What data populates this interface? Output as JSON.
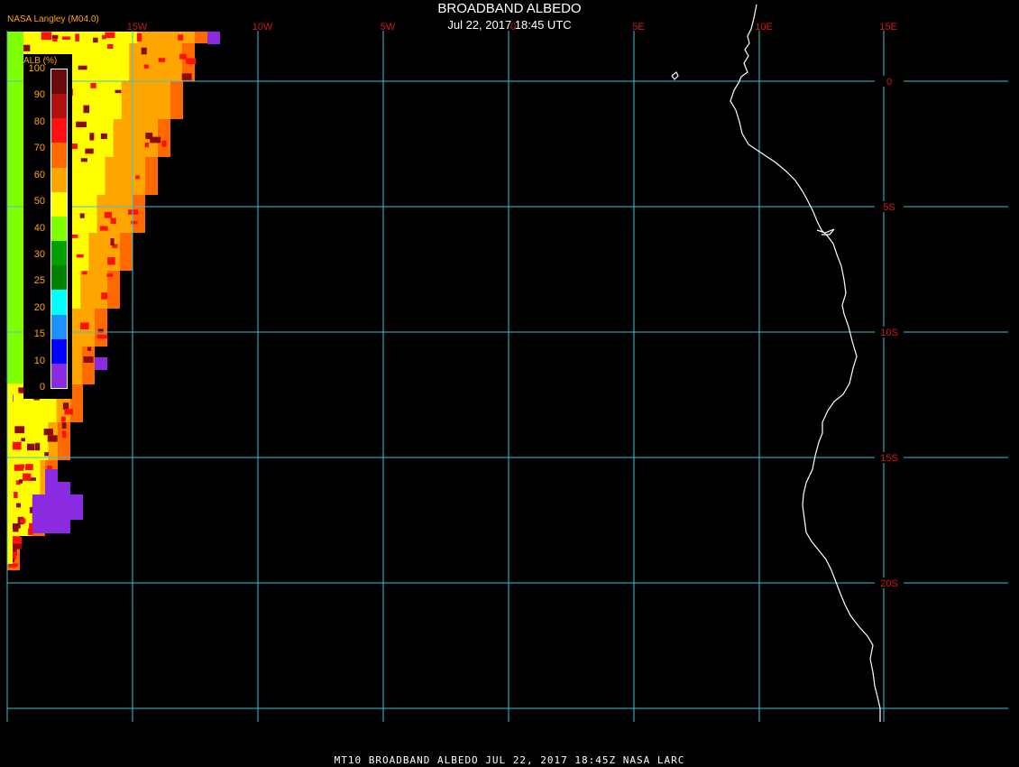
{
  "title": "BROADBAND ALBEDO",
  "subtitle": "Jul 22, 2017 18:45 UTC",
  "credit": "NASA Langley (M04.0)",
  "footer": "MT10  BROADBAND ALBEDO   JUL 22, 2017 18:45Z   NASA LARC",
  "legend": {
    "title": "ALB (%)",
    "ticks": [
      "100",
      "90",
      "80",
      "70",
      "60",
      "50",
      "40",
      "30",
      "25",
      "20",
      "15",
      "10",
      "0"
    ],
    "colors": [
      "#6b0a0a",
      "#b01010",
      "#ff1010",
      "#ff6a00",
      "#ffa500",
      "#ffff00",
      "#80ff00",
      "#00a000",
      "#008000",
      "#00ffff",
      "#1e90ff",
      "#0000ff",
      "#8a2be2"
    ]
  },
  "map": {
    "lon_labels": [
      "15W",
      "10W",
      "5W",
      "0",
      "5E",
      "10E",
      "15E"
    ],
    "lat_labels": [
      "0",
      "5S",
      "10S",
      "15S",
      "20S"
    ],
    "grid_color": "#40c0d8",
    "label_color": "#d01818",
    "coast_color": "#ffffff"
  }
}
